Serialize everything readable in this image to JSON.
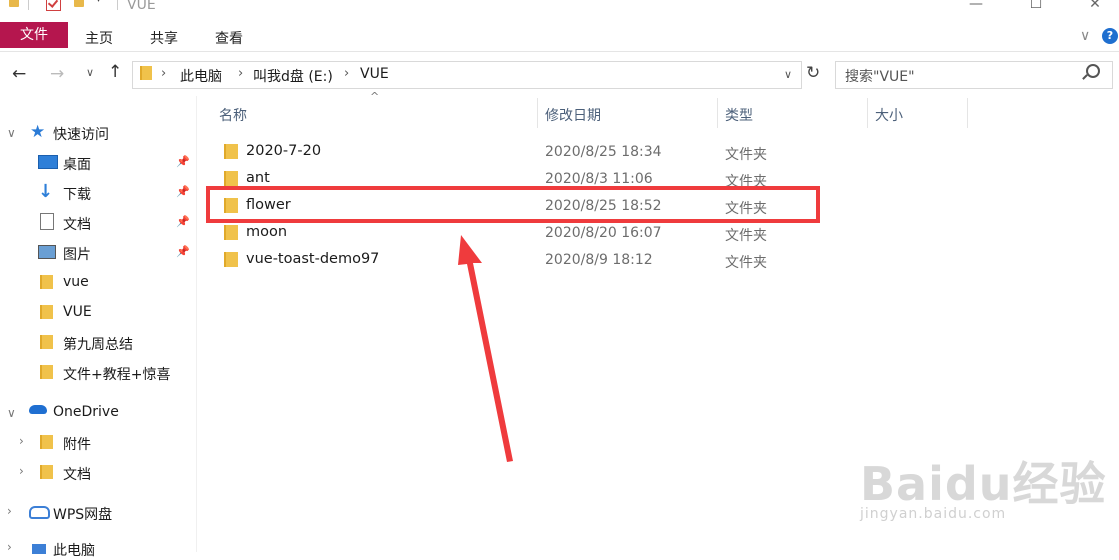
{
  "window": {
    "title": "VUE",
    "minimize": "—",
    "maximize": "☐",
    "close": "✕"
  },
  "ribbon": {
    "tabs": [
      "文件",
      "主页",
      "共享",
      "查看"
    ],
    "collapse": "∨",
    "help": "?"
  },
  "address": {
    "crumbs": [
      "此电脑",
      "叫我d盘 (E:)",
      "VUE"
    ],
    "search_placeholder": "搜索\"VUE\""
  },
  "sidebar": {
    "quick_access": "快速访问",
    "quick_items": [
      {
        "label": "桌面",
        "icon": "desktop-icon",
        "pinned": true
      },
      {
        "label": "下载",
        "icon": "download-icon",
        "pinned": true
      },
      {
        "label": "文档",
        "icon": "document-icon",
        "pinned": true
      },
      {
        "label": "图片",
        "icon": "pictures-icon",
        "pinned": true
      },
      {
        "label": "vue",
        "icon": "folder-icon",
        "pinned": false
      },
      {
        "label": "VUE",
        "icon": "folder-icon",
        "pinned": false
      },
      {
        "label": "第九周总结",
        "icon": "folder-icon",
        "pinned": false
      },
      {
        "label": "文件+教程+惊喜",
        "icon": "folder-icon",
        "pinned": false
      }
    ],
    "onedrive": "OneDrive",
    "onedrive_items": [
      "附件",
      "文档"
    ],
    "wps": "WPS网盘",
    "this_pc": "此电脑"
  },
  "columns": {
    "name": "名称",
    "date": "修改日期",
    "type": "类型",
    "size": "大小"
  },
  "files": [
    {
      "name": "2020-7-20",
      "date": "2020/8/25 18:34",
      "type": "文件夹"
    },
    {
      "name": "ant",
      "date": "2020/8/3 11:06",
      "type": "文件夹"
    },
    {
      "name": "flower",
      "date": "2020/8/25 18:52",
      "type": "文件夹"
    },
    {
      "name": "moon",
      "date": "2020/8/20 16:07",
      "type": "文件夹"
    },
    {
      "name": "vue-toast-demo97",
      "date": "2020/8/9 18:12",
      "type": "文件夹"
    }
  ],
  "colors": {
    "file_tab": "#b5164e",
    "highlight": "#ef3b3d",
    "folder": "#f0c24b"
  },
  "watermark": {
    "logo": "Baidu经验",
    "url": "jingyan.baidu.com"
  }
}
